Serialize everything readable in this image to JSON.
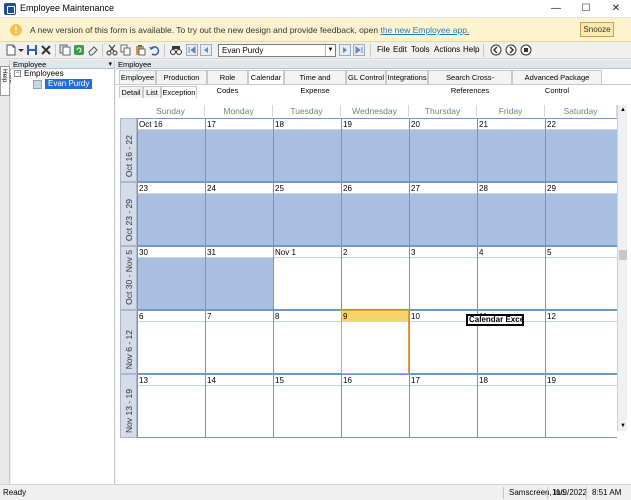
{
  "window": {
    "title": "Employee Maintenance",
    "minimize": "—",
    "maximize": "☐",
    "close": "✕"
  },
  "banner": {
    "message": "A new version of this form is available. To try out the new design and provide feedback, open",
    "link": "the new Employee app.",
    "snooze": "Snooze",
    "icon": "info-icon"
  },
  "toolbar": {
    "employee_combo": "Evan Purdy",
    "menu": [
      "File",
      "Edit",
      "Tools",
      "Actions",
      "Help"
    ]
  },
  "sidebar": {
    "strip_label": "Field Help",
    "panel_title": "Employee",
    "tree_root": "Employees",
    "tree_child": "Evan Purdy"
  },
  "main": {
    "panel_title": "Employee",
    "tabs": [
      "Employee",
      "Production Info",
      "Role Codes",
      "Calendar",
      "Time and Expense",
      "GL Control",
      "Integrations",
      "Search Cross-References",
      "Advanced Package Control"
    ],
    "active_tab": "Calendar",
    "subtabs": [
      "Detail",
      "List",
      "Exception"
    ],
    "active_subtab": "Exception"
  },
  "calendar": {
    "days": [
      "Sunday",
      "Monday",
      "Tuesday",
      "Wednesday",
      "Thursday",
      "Friday",
      "Saturday"
    ],
    "weeks": [
      {
        "label": "Oct 16 - 22",
        "dates": [
          "Oct 16",
          "17",
          "18",
          "19",
          "20",
          "21",
          "22"
        ],
        "shaded": [
          true,
          true,
          true,
          true,
          true,
          true,
          true
        ]
      },
      {
        "label": "Oct 23 - 29",
        "dates": [
          "23",
          "24",
          "25",
          "26",
          "27",
          "28",
          "29"
        ],
        "shaded": [
          true,
          true,
          true,
          true,
          true,
          true,
          true
        ]
      },
      {
        "label": "Oct 30 - Nov 5",
        "dates": [
          "30",
          "31",
          "Nov 1",
          "2",
          "3",
          "4",
          "5"
        ],
        "shaded": [
          true,
          true,
          false,
          false,
          false,
          false,
          false
        ]
      },
      {
        "label": "Nov 6 - 12",
        "dates": [
          "6",
          "7",
          "8",
          "9",
          "10",
          "11",
          "12"
        ],
        "shaded": [
          false,
          false,
          false,
          false,
          false,
          false,
          false
        ]
      },
      {
        "label": "Nov 13 - 19",
        "dates": [
          "13",
          "14",
          "15",
          "16",
          "17",
          "18",
          "19"
        ],
        "shaded": [
          false,
          false,
          false,
          false,
          false,
          false,
          false
        ]
      }
    ],
    "today_week": 3,
    "today_day": 3,
    "event": {
      "text": "Calendar Exce",
      "week": 3,
      "day": 5
    }
  },
  "status": {
    "left": "Ready",
    "company": "Samscreen, Inc.",
    "date": "11/9/2022",
    "time": "8:51 AM"
  }
}
